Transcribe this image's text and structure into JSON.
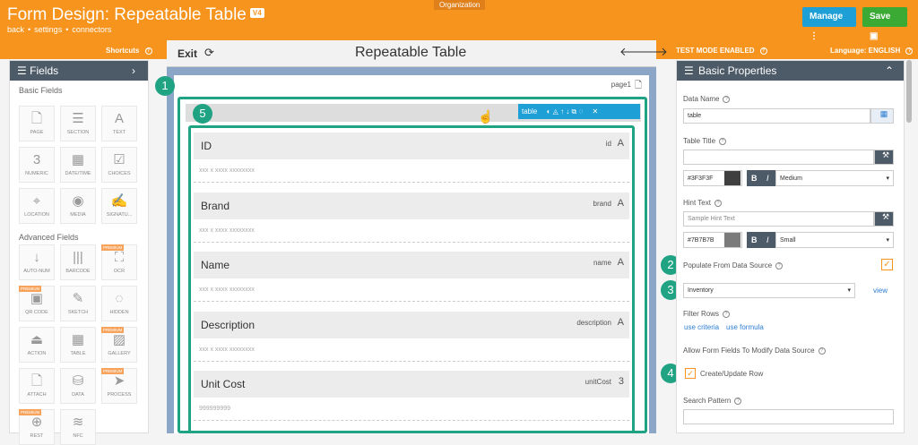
{
  "header": {
    "title": "Form Design: Repeatable Table",
    "version_badge": "V4",
    "links": [
      "back",
      "settings",
      "connectors"
    ],
    "org_tab": "Organization",
    "manage_label": "Manage",
    "save_label": "Save",
    "colors": {
      "brand": "#f7941d",
      "manage": "#1e9fd6",
      "save": "#3aaa35"
    }
  },
  "subbar": {
    "shortcuts": "Shortcuts",
    "test_mode": "TEST MODE ENABLED",
    "language": "Language: ENGLISH"
  },
  "left_panel": {
    "title": "Fields",
    "basic_group": "Basic Fields",
    "advanced_group": "Advanced Fields",
    "premium_label": "PREMIUM",
    "basic": [
      {
        "label": "PAGE",
        "icon": "page-icon",
        "glyph": "🗋"
      },
      {
        "label": "SECTION",
        "icon": "section-icon",
        "glyph": "☰"
      },
      {
        "label": "TEXT",
        "icon": "text-icon",
        "glyph": "A"
      },
      {
        "label": "NUMERIC",
        "icon": "numeric-icon",
        "glyph": "3"
      },
      {
        "label": "DATE/TIME",
        "icon": "calendar-icon",
        "glyph": "▦"
      },
      {
        "label": "CHOICES",
        "icon": "checkbox-icon",
        "glyph": "☑"
      },
      {
        "label": "LOCATION",
        "icon": "location-pin-icon",
        "glyph": "⌖"
      },
      {
        "label": "MEDIA",
        "icon": "camera-icon",
        "glyph": "◉"
      },
      {
        "label": "SIGNATU...",
        "icon": "signature-icon",
        "glyph": "✍"
      }
    ],
    "advanced": [
      {
        "label": "AUTO-NUM",
        "icon": "auto-number-icon",
        "glyph": "↓"
      },
      {
        "label": "BARCODE",
        "icon": "barcode-icon",
        "glyph": "|||"
      },
      {
        "label": "OCR",
        "icon": "ocr-icon",
        "glyph": "⛶"
      },
      {
        "label": "QR CODE",
        "icon": "qr-code-icon",
        "glyph": "▣"
      },
      {
        "label": "SKETCH",
        "icon": "pencil-icon",
        "glyph": "✎"
      },
      {
        "label": "HIDDEN",
        "icon": "eye-slash-icon",
        "glyph": "◌"
      },
      {
        "label": "ACTION",
        "icon": "action-icon",
        "glyph": "⏏"
      },
      {
        "label": "TABLE",
        "icon": "table-icon",
        "glyph": "▦"
      },
      {
        "label": "GALLERY",
        "icon": "gallery-icon",
        "glyph": "▨"
      },
      {
        "label": "ATTACH",
        "icon": "attach-icon",
        "glyph": "🗋"
      },
      {
        "label": "DATA",
        "icon": "database-icon",
        "glyph": "⛁"
      },
      {
        "label": "PROCESS",
        "icon": "send-icon",
        "glyph": "➤"
      },
      {
        "label": "REST",
        "icon": "globe-icon",
        "glyph": "⊕"
      },
      {
        "label": "NFC",
        "icon": "wifi-icon",
        "glyph": "≋"
      }
    ]
  },
  "canvas": {
    "exit_label": "Exit",
    "title": "Repeatable Table",
    "page_label": "page1",
    "table_tag": "table",
    "rows": [
      {
        "label": "ID",
        "name": "id",
        "type": "A",
        "placeholder": "xxx x xxxx xxxxxxxx"
      },
      {
        "label": "Brand",
        "name": "brand",
        "type": "A",
        "placeholder": "xxx x xxxx xxxxxxxx"
      },
      {
        "label": "Name",
        "name": "name",
        "type": "A",
        "placeholder": "xxx x xxxx xxxxxxxx"
      },
      {
        "label": "Description",
        "name": "description",
        "type": "A",
        "placeholder": "xxx x xxxx xxxxxxxx"
      },
      {
        "label": "Unit Cost",
        "name": "unitCost",
        "type": "3",
        "placeholder": "999999999"
      }
    ],
    "markers": [
      "1",
      "2",
      "3",
      "4",
      "5"
    ]
  },
  "right_panel": {
    "title": "Basic Properties",
    "data_name_label": "Data Name",
    "data_name_value": "table",
    "table_title_label": "Table Title",
    "table_title_value": "",
    "title_color": "#3F3F3F",
    "title_size": "Medium",
    "hint_text_label": "Hint Text",
    "hint_text_placeholder": "Sample Hint Text",
    "hint_color": "#7B7B7B",
    "hint_size": "Small",
    "populate_label": "Populate From Data Source",
    "data_source_value": "Inventory",
    "view_link": "view",
    "filter_rows_label": "Filter Rows",
    "use_criteria": "use criteria",
    "use_formula": "use formula",
    "allow_modify_label": "Allow Form Fields To Modify Data Source",
    "create_update_label": "Create/Update Row",
    "search_pattern_label": "Search Pattern",
    "bold_label": "B",
    "italic_label": "I"
  }
}
